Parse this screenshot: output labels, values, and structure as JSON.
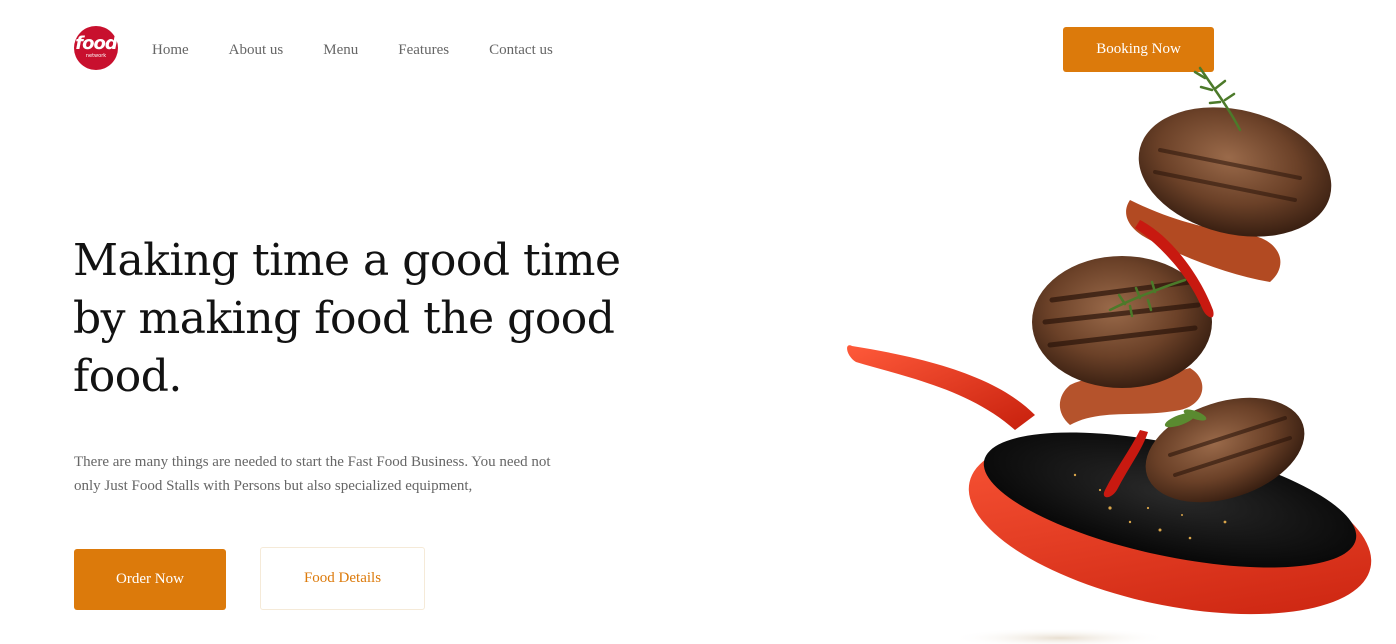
{
  "brand": {
    "logo_word": "food",
    "logo_sub": "network"
  },
  "nav": [
    {
      "label": "Home"
    },
    {
      "label": "About us"
    },
    {
      "label": "Menu"
    },
    {
      "label": "Features"
    },
    {
      "label": "Contact us"
    }
  ],
  "header": {
    "booking_label": "Booking Now"
  },
  "hero": {
    "headline": "Making time a good time by making food the good food.",
    "description": "There are many things are needed to start the Fast Food Business. You need not only Just Food Stalls with Persons but also specialized equipment,",
    "order_label": "Order Now",
    "details_label": "Food Details"
  },
  "image": {
    "subject": "frying-pan-with-flying-burger-patties"
  },
  "colors": {
    "accent": "#dc7a0b",
    "logo": "#c8102e",
    "pan": "#e8331c",
    "heading": "#121212",
    "muted": "#666666"
  }
}
